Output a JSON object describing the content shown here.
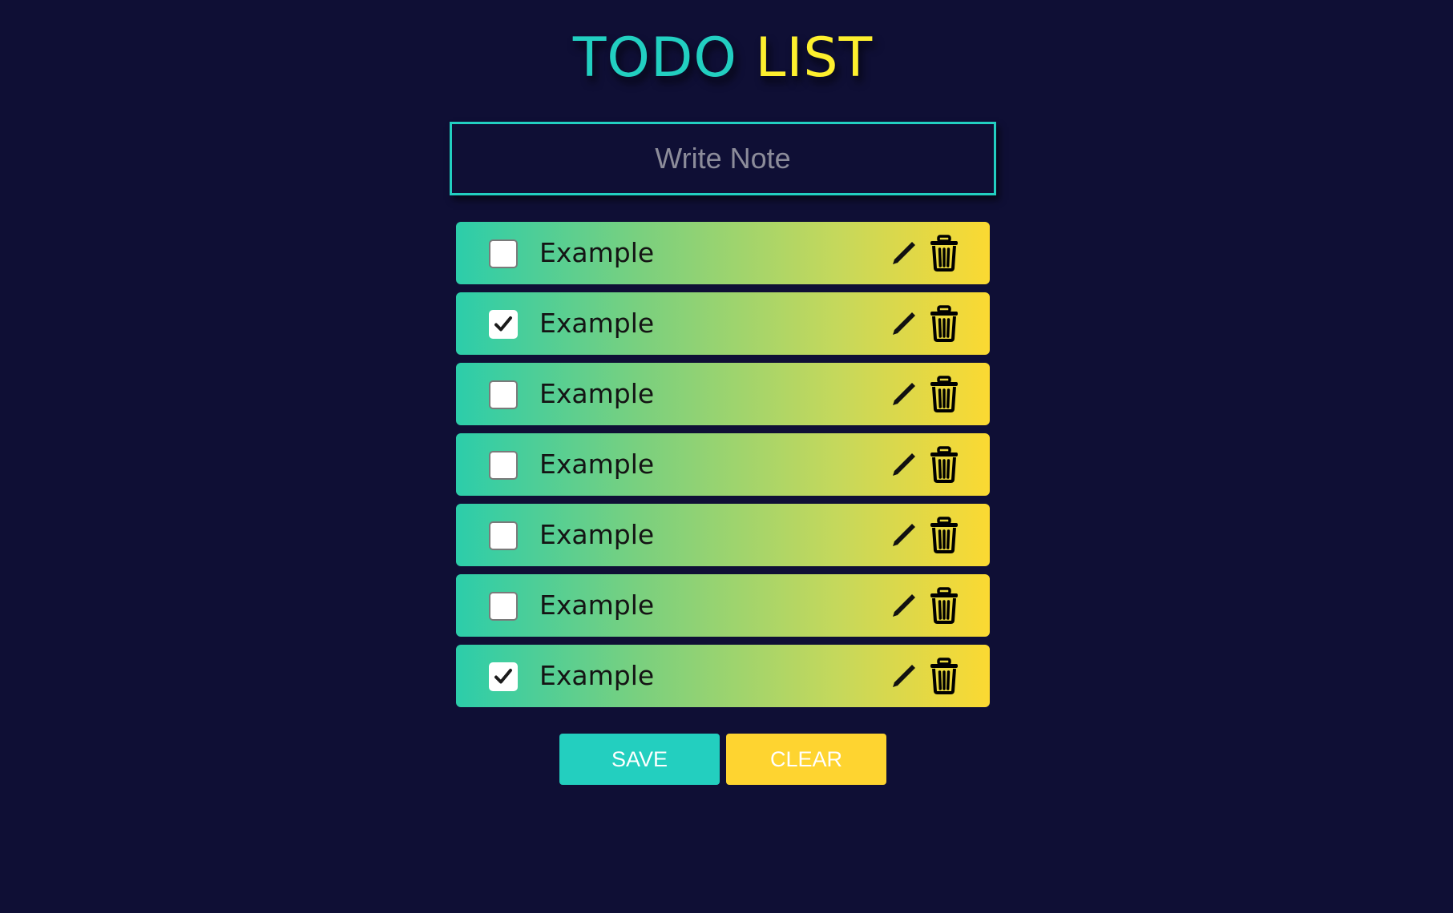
{
  "header": {
    "title_part1": "TODO",
    "title_part2": "LIST"
  },
  "note_input": {
    "placeholder": "Write Note",
    "value": ""
  },
  "todos": [
    {
      "text": "Example",
      "checked": false
    },
    {
      "text": "Example",
      "checked": true
    },
    {
      "text": "Example",
      "checked": false
    },
    {
      "text": "Example",
      "checked": false
    },
    {
      "text": "Example",
      "checked": false
    },
    {
      "text": "Example",
      "checked": false
    },
    {
      "text": "Example",
      "checked": true
    }
  ],
  "icons": {
    "edit": "pencil-icon",
    "delete": "trash-icon",
    "check": "checkmark-icon"
  },
  "buttons": {
    "save_label": "SAVE",
    "clear_label": "CLEAR"
  },
  "colors": {
    "background": "#0f0f35",
    "teal": "#22cfc1",
    "yellow": "#fdef2e",
    "save_button": "#23cfbf",
    "clear_button": "#fed430"
  }
}
